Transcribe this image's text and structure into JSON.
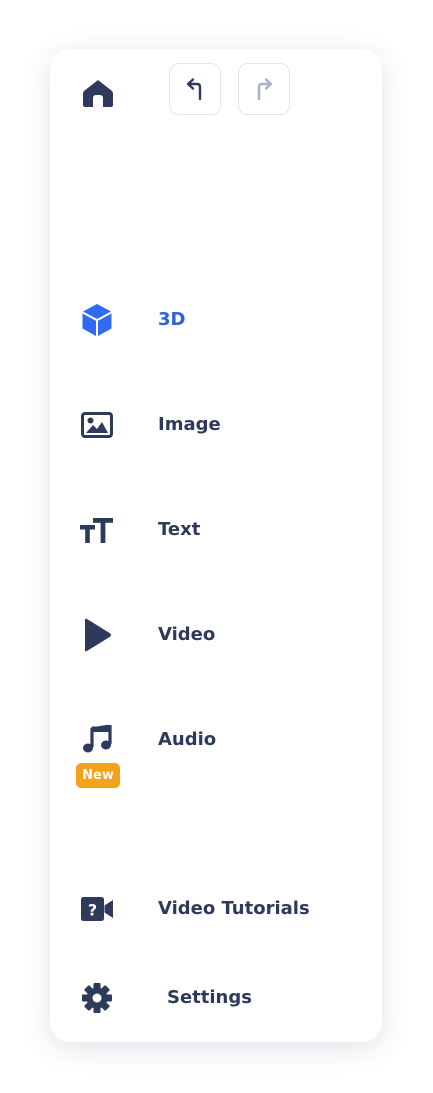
{
  "header": {
    "home_icon": "home-icon",
    "undo_icon": "undo-arrow-icon",
    "redo_icon": "redo-arrow-icon"
  },
  "nav": {
    "items": [
      {
        "id": "3d",
        "label": "3D",
        "icon": "cube-icon",
        "active": true
      },
      {
        "id": "image",
        "label": "Image",
        "icon": "image-icon"
      },
      {
        "id": "text",
        "label": "Text",
        "icon": "text-size-icon"
      },
      {
        "id": "video",
        "label": "Video",
        "icon": "play-icon"
      },
      {
        "id": "audio",
        "label": "Audio",
        "icon": "music-note-icon",
        "badge": "New"
      },
      {
        "id": "video-tutorials",
        "label": "Video Tutorials",
        "icon": "video-question-icon"
      },
      {
        "id": "settings",
        "label": "Settings",
        "icon": "gear-icon"
      }
    ]
  },
  "colors": {
    "text": "#2e3a5c",
    "accent": "#2f62d6",
    "icon_dark": "#2e3a5c",
    "icon_active": "#2f6af0",
    "badge": "#f3a21a",
    "disabled": "#a9b1c8"
  }
}
